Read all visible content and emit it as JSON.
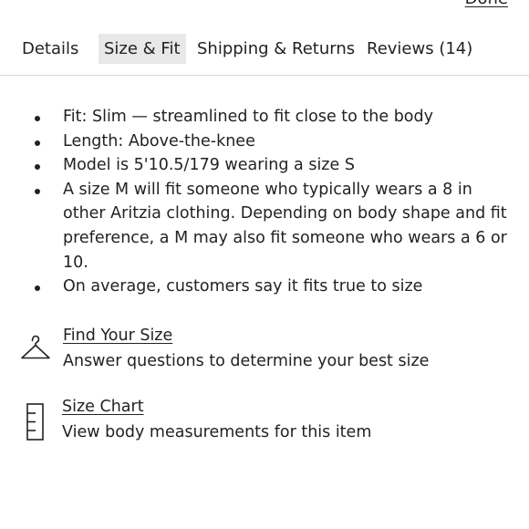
{
  "header": {
    "done_label": "Done"
  },
  "tabs": [
    {
      "label": "Details"
    },
    {
      "label": "Size & Fit"
    },
    {
      "label": "Shipping & Returns"
    },
    {
      "label": "Reviews (14)"
    }
  ],
  "fit_details": [
    "Fit: Slim — streamlined to fit close to the body",
    "Length: Above-the-knee",
    "Model is 5'10.5/179 wearing a size S",
    "A size M will fit someone who typically wears a 8 in other Aritzia clothing. Depending on body shape and fit preference, a M may also fit someone who wears a 6 or 10.",
    "On average, customers say it fits true to size"
  ],
  "find_your_size": {
    "title": "Find Your Size",
    "description": "Answer questions to determine your best size",
    "icon": "hanger-icon"
  },
  "size_chart": {
    "title": "Size Chart",
    "description": "View body measurements for this item",
    "icon": "ruler-icon"
  }
}
